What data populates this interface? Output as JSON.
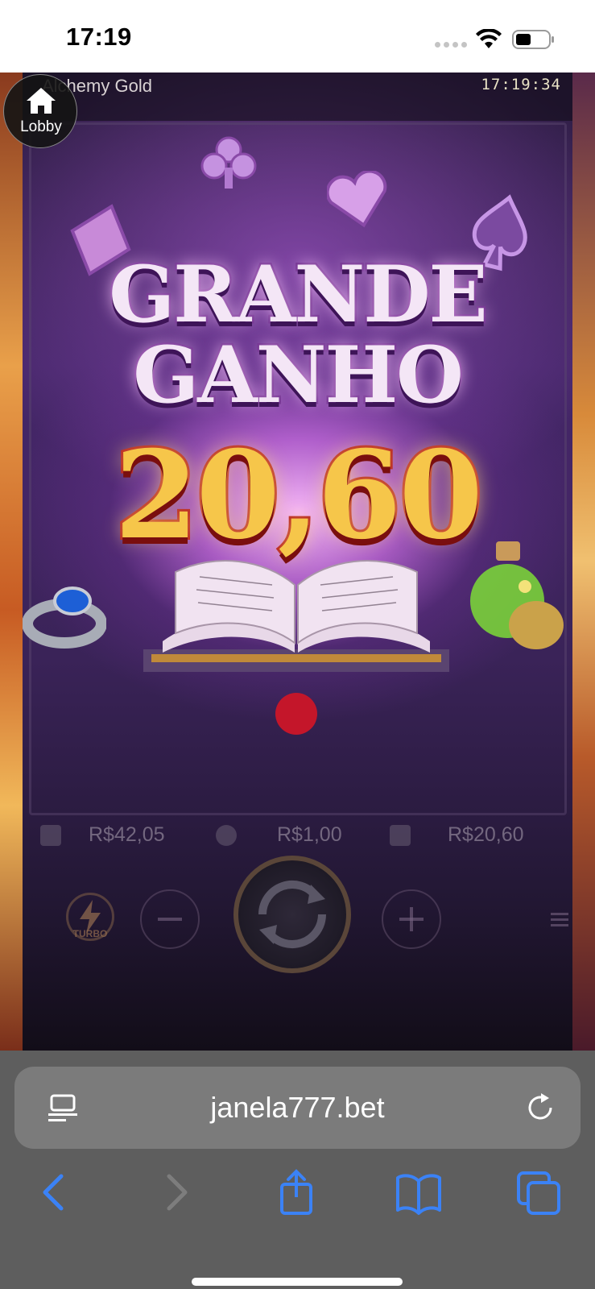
{
  "status_bar": {
    "time": "17:19"
  },
  "game": {
    "title": "Alchemy Gold",
    "clock": "17:19:34",
    "lobby_label": "Lobby",
    "win_title_line1": "GRANDE",
    "win_title_line2": "GANHO",
    "win_amount": "20,60",
    "balance": "R$42,05",
    "bet": "R$1,00",
    "win": "R$20,60",
    "turbo_label": "TURBO"
  },
  "browser": {
    "url": "janela777.bet"
  },
  "colors": {
    "accent_blue": "#3b82f6",
    "win_gold": "#f6c64a",
    "win_stroke_red": "#b41a1a",
    "title_purple": "#6a2a8a"
  }
}
